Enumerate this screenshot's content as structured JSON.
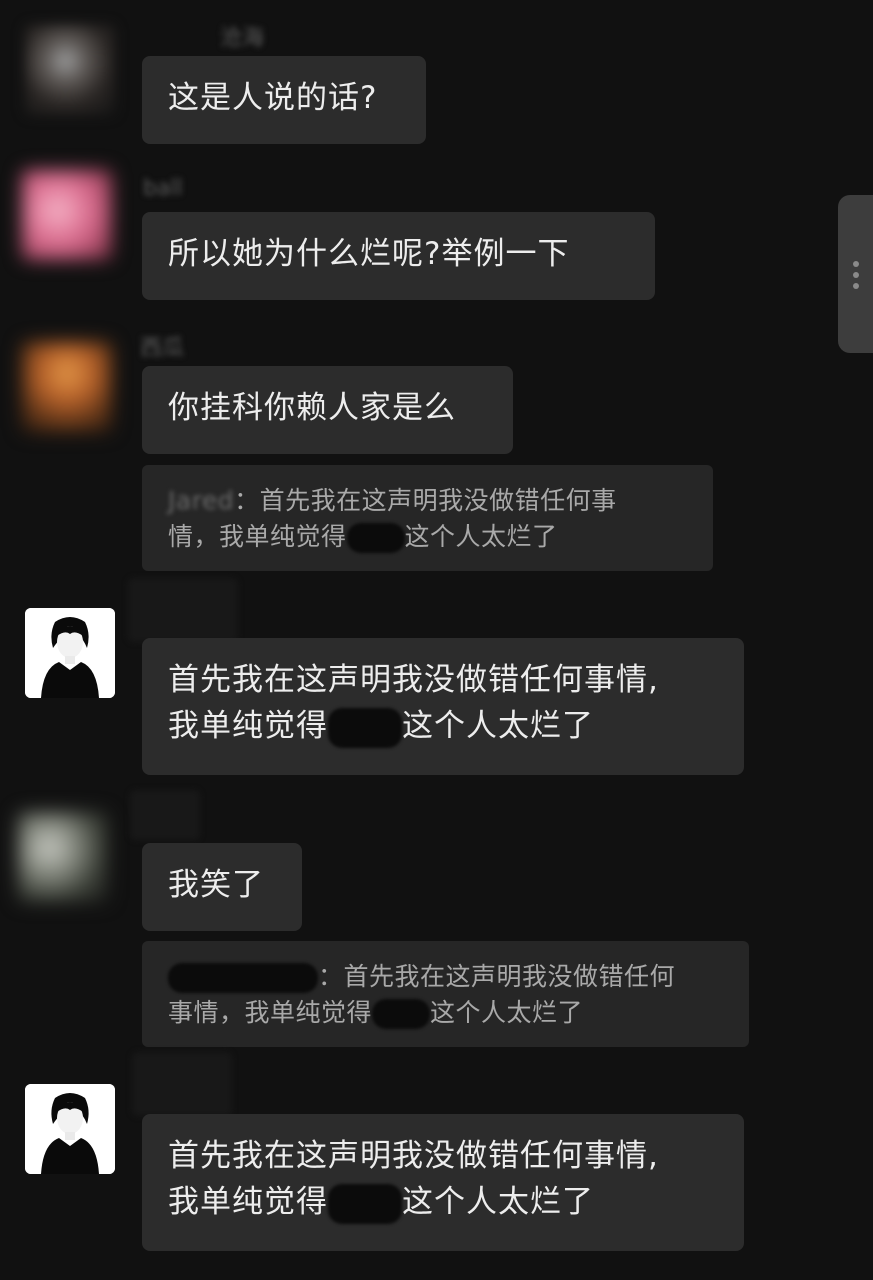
{
  "messages": [
    {
      "sender": "沧海",
      "text": "这是人说的话?"
    },
    {
      "sender": "ball",
      "text": "所以她为什么烂呢?举例一下"
    },
    {
      "sender": "西瓜",
      "text": "你挂科你赖人家是么"
    },
    {
      "quote": {
        "name": "Jared",
        "line1_rest": "：首先我在这声明我没做错任何事",
        "line2_before": "情，我单纯觉得",
        "line2_after": "这个人太烂了"
      },
      "line1": "首先我在这声明我没做错任何事情,",
      "line2_before": "我单纯觉得",
      "line2_after": "这个人太烂了"
    },
    {
      "text": "我笑了"
    },
    {
      "quote": {
        "line1_rest": "：首先我在这声明我没做错任何",
        "line2_before": "事情，我单纯觉得",
        "line2_after": "这个人太烂了"
      },
      "line1": "首先我在这声明我没做错任何事情,",
      "line2_before": "我单纯觉得",
      "line2_after": "这个人太烂了"
    }
  ],
  "icons": {
    "side_panel": "more-vertical-icon"
  },
  "colors": {
    "background": "#111111",
    "bubble": "#2c2c2c",
    "quote": "#262626",
    "text": "#ededed"
  }
}
